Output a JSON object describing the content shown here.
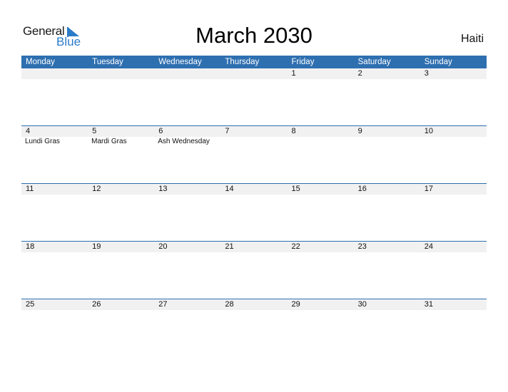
{
  "logo": {
    "word1": "General",
    "word2": "Blue"
  },
  "title": "March 2030",
  "country": "Haiti",
  "colors": {
    "header": "#2e6fb0",
    "accent": "#2a7bc8",
    "date_bar": "#f1f1f1"
  },
  "weekdays": [
    "Monday",
    "Tuesday",
    "Wednesday",
    "Thursday",
    "Friday",
    "Saturday",
    "Sunday"
  ],
  "weeks": [
    {
      "days": [
        "",
        "",
        "",
        "",
        "1",
        "2",
        "3"
      ],
      "events": [
        "",
        "",
        "",
        "",
        "",
        "",
        ""
      ]
    },
    {
      "days": [
        "4",
        "5",
        "6",
        "7",
        "8",
        "9",
        "10"
      ],
      "events": [
        "Lundi Gras",
        "Mardi Gras",
        "Ash Wednesday",
        "",
        "",
        "",
        ""
      ]
    },
    {
      "days": [
        "11",
        "12",
        "13",
        "14",
        "15",
        "16",
        "17"
      ],
      "events": [
        "",
        "",
        "",
        "",
        "",
        "",
        ""
      ]
    },
    {
      "days": [
        "18",
        "19",
        "20",
        "21",
        "22",
        "23",
        "24"
      ],
      "events": [
        "",
        "",
        "",
        "",
        "",
        "",
        ""
      ]
    },
    {
      "days": [
        "25",
        "26",
        "27",
        "28",
        "29",
        "30",
        "31"
      ],
      "events": [
        "",
        "",
        "",
        "",
        "",
        "",
        ""
      ]
    }
  ]
}
